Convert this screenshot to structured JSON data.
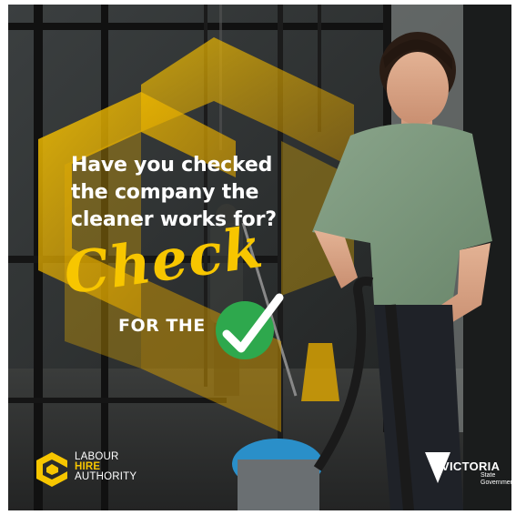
{
  "headline": {
    "line1": "Have you checked",
    "line2": "the company the",
    "line3": "cleaner works for?"
  },
  "campaign": {
    "script_word": "Check",
    "for_the": "FOR THE"
  },
  "logos": {
    "lha_line1": "LABOUR",
    "lha_line2": "HIRE",
    "lha_line3": "AUTHORITY",
    "victoria": "VICTORIA",
    "victoria_sub1": "State",
    "victoria_sub2": "Government"
  },
  "colors": {
    "accent_yellow": "#f7c600",
    "tick_green": "#2ea84d",
    "shirt_green": "#7f9b80",
    "background_dark": "#2a2c2c"
  }
}
